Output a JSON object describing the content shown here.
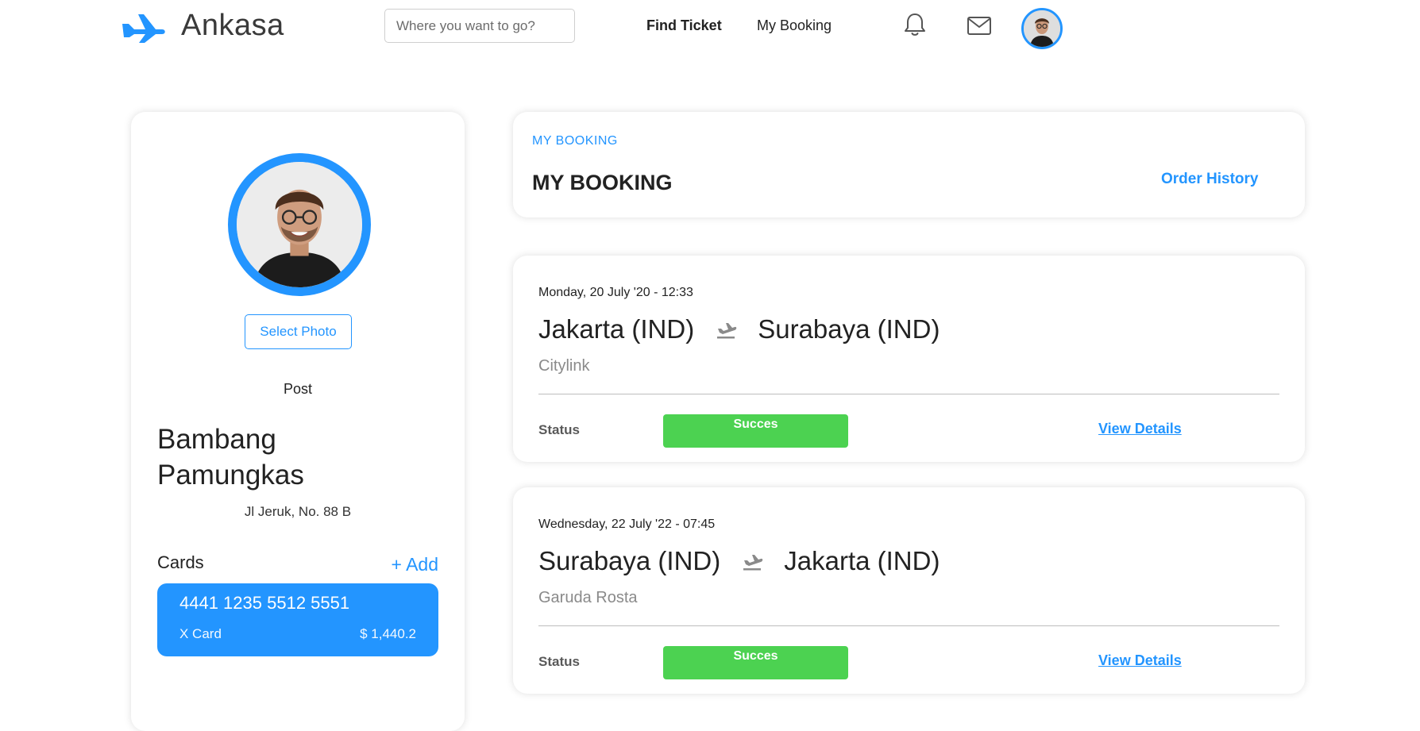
{
  "header": {
    "brand": "Ankasa",
    "search_placeholder": "Where you want to go?",
    "nav": {
      "find_ticket": "Find Ticket",
      "my_booking": "My Booking"
    },
    "icons": [
      "bell-icon",
      "mail-icon"
    ]
  },
  "profile": {
    "select_photo_label": "Select Photo",
    "post": "Post",
    "name": "Bambang Pamungkas",
    "address": "Jl Jeruk, No. 88 B",
    "cards_label": "Cards",
    "add_label": "+ Add",
    "card": {
      "number": "4441 1235 5512 5551",
      "type": "X Card",
      "balance": "$ 1,440.2"
    }
  },
  "booking_header": {
    "eyebrow": "MY BOOKING",
    "title": "MY BOOKING",
    "history_link": "Order History"
  },
  "bookings": [
    {
      "date": "Monday, 20 July '20 - 12:33",
      "from": "Jakarta (IND)",
      "to": "Surabaya (IND)",
      "airline": "Citylink",
      "status_label": "Status",
      "status": "Succes",
      "details_label": "View Details"
    },
    {
      "date": "Wednesday, 22 July '22 - 07:45",
      "from": "Surabaya (IND)",
      "to": "Jakarta (IND)",
      "airline": "Garuda Rosta",
      "status_label": "Status",
      "status": "Succes",
      "details_label": "View Details"
    }
  ],
  "colors": {
    "accent": "#2395ff",
    "success": "#4cd251",
    "text": "#222222",
    "muted": "#8a8a8a"
  }
}
